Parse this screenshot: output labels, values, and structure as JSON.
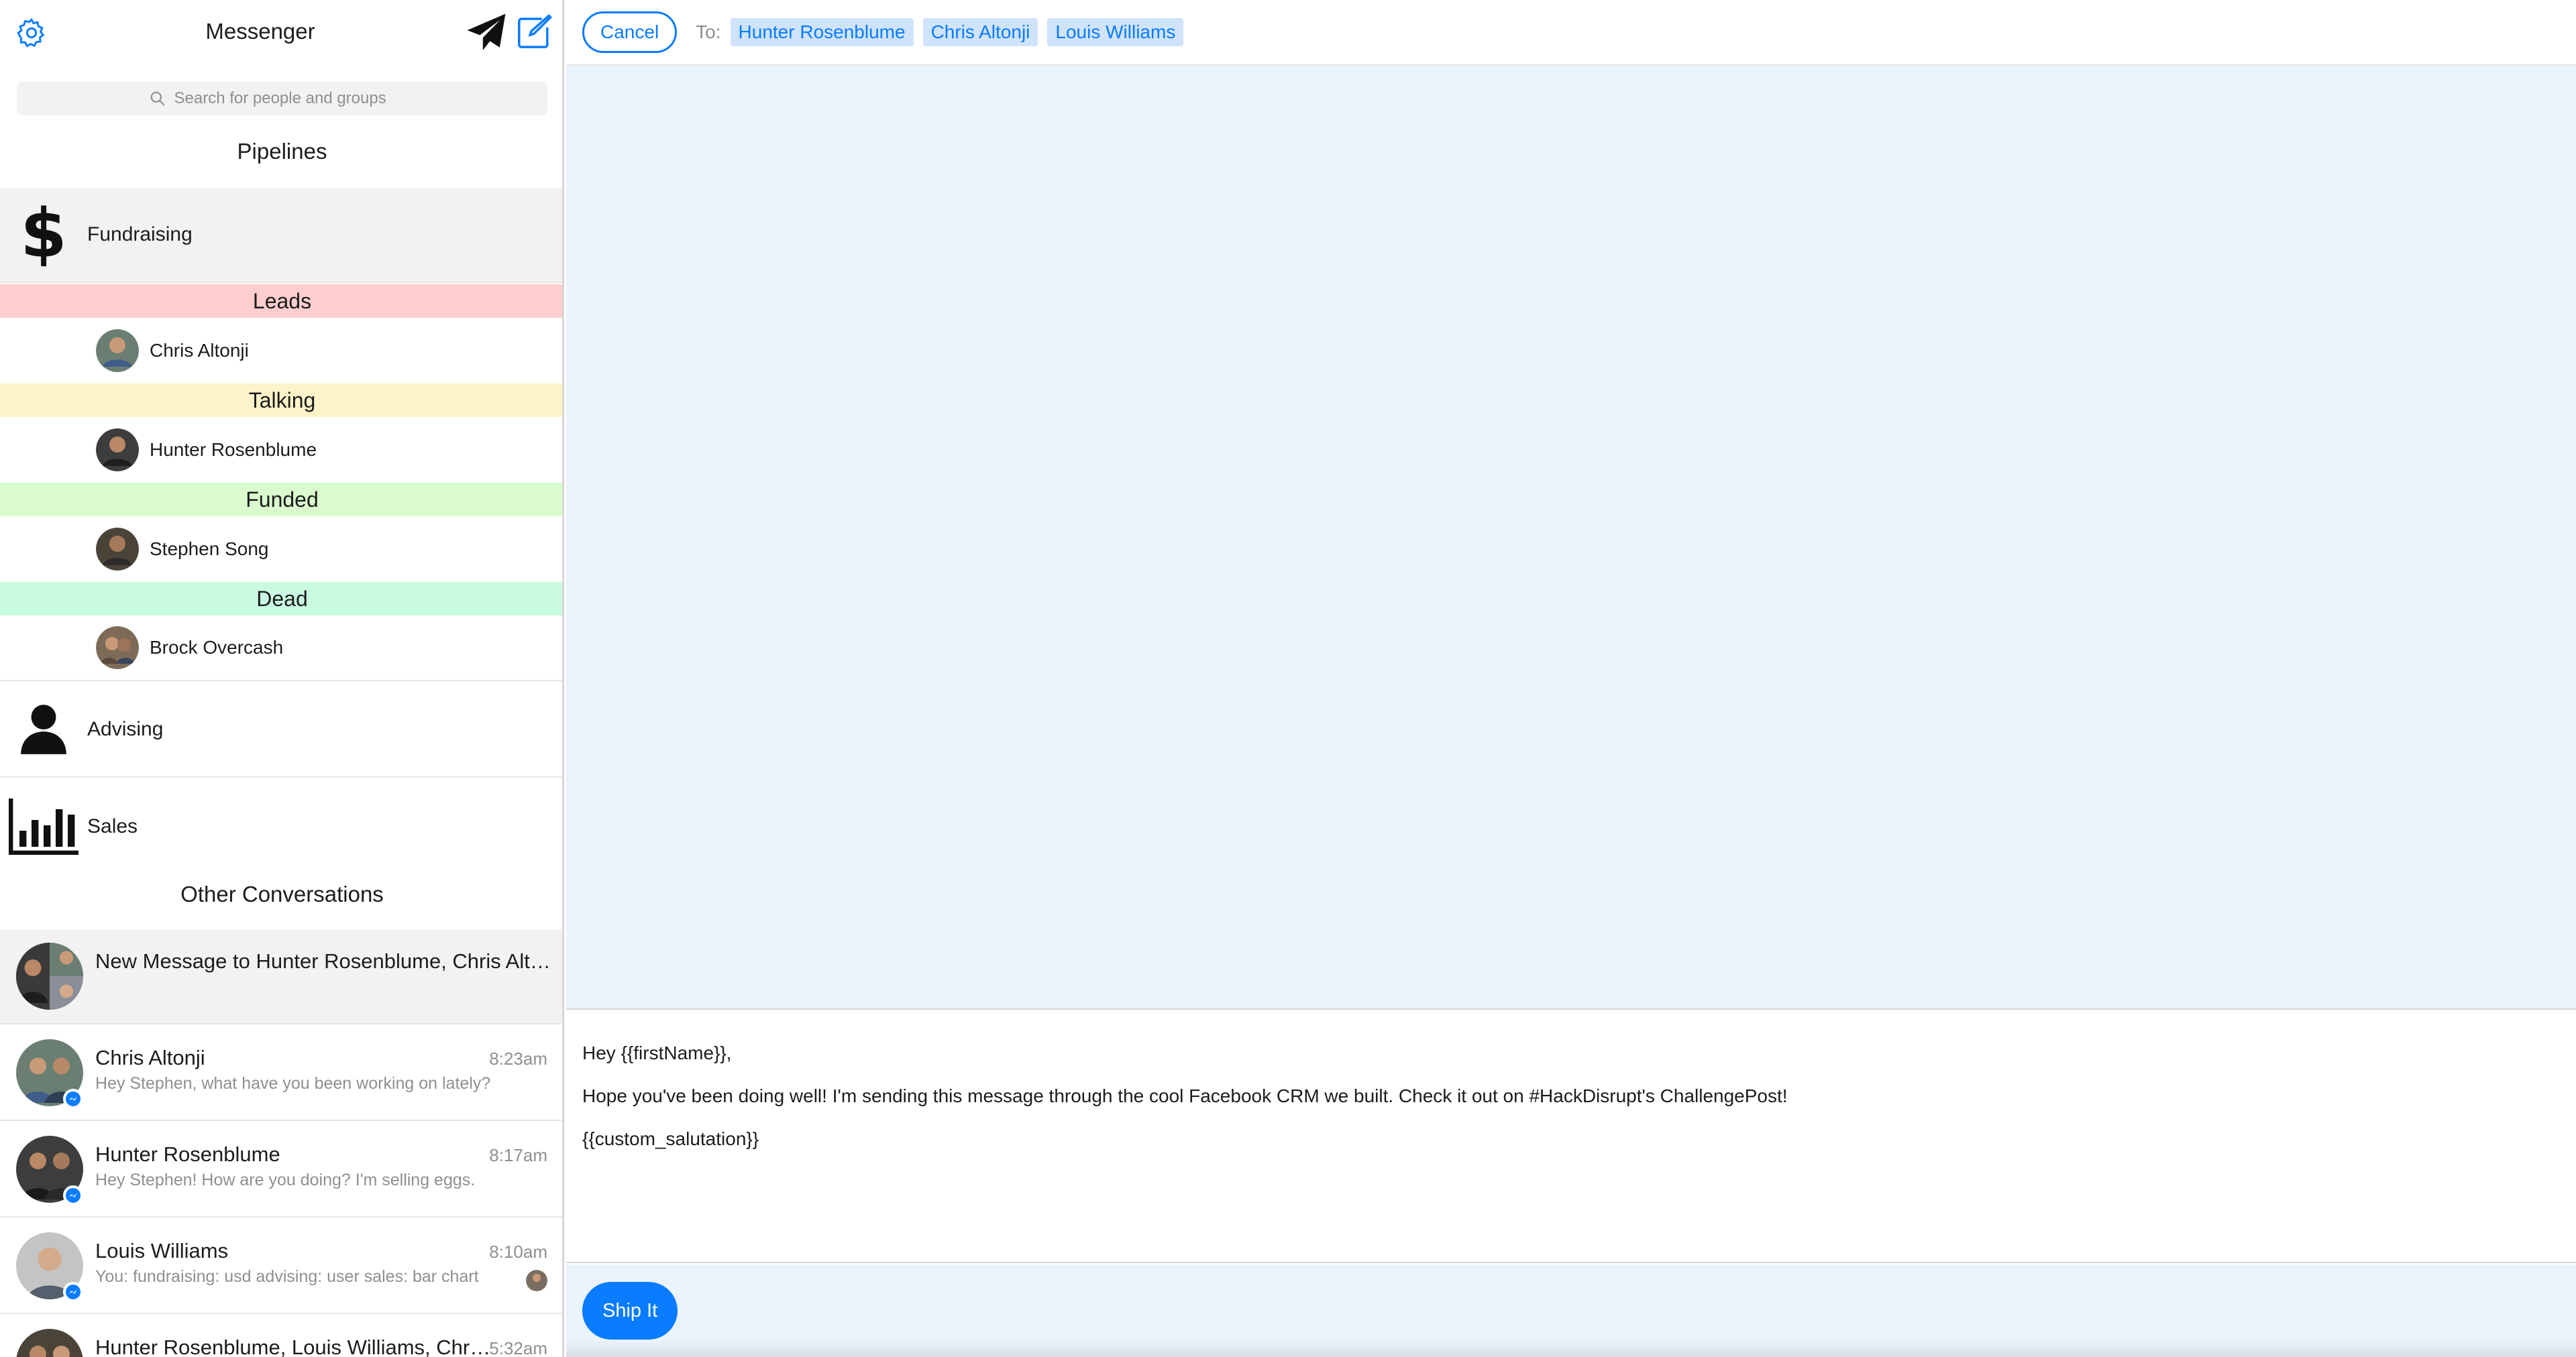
{
  "app": {
    "title": "Messenger"
  },
  "search": {
    "placeholder": "Search for people and groups"
  },
  "pipelines": {
    "heading": "Pipelines",
    "fundraising": {
      "label": "Fundraising",
      "stages": [
        {
          "name": "Leads",
          "color": "#fecdcd",
          "person": "Chris Altonji"
        },
        {
          "name": "Talking",
          "color": "#fdf3c8",
          "person": "Hunter Rosenblume"
        },
        {
          "name": "Funded",
          "color": "#d9fbce",
          "person": "Stephen Song"
        },
        {
          "name": "Dead",
          "color": "#c9fbe0",
          "person": "Brock Overcash"
        }
      ]
    },
    "advising": {
      "label": "Advising"
    },
    "sales": {
      "label": "Sales"
    }
  },
  "other": {
    "heading": "Other Conversations",
    "conversations": [
      {
        "name": "New Message to Hunter Rosenblume, Chris Altonji, Louis Williams",
        "time": "",
        "preview": ""
      },
      {
        "name": "Chris Altonji",
        "time": "8:23am",
        "preview": "Hey Stephen, what have you been working on lately?"
      },
      {
        "name": "Hunter Rosenblume",
        "time": "8:17am",
        "preview": "Hey Stephen! How are you doing? I'm selling eggs."
      },
      {
        "name": "Louis Williams",
        "time": "8:10am",
        "preview": "You: fundraising: usd advising: user sales: bar chart"
      },
      {
        "name": "Hunter Rosenblume, Louis Williams, Chris Altonji",
        "time": "5:32am",
        "preview": ""
      }
    ]
  },
  "compose": {
    "cancel_label": "Cancel",
    "to_label": "To:",
    "recipients": [
      "Hunter Rosenblume",
      "Chris Altonji",
      "Louis Williams"
    ],
    "lines": [
      "Hey {{firstName}},",
      "Hope you've been doing well! I'm sending this message through the cool Facebook CRM we built. Check it out on #HackDisrupt's ChallengePost!",
      "{{custom_salutation}}"
    ],
    "send_label": "Ship It"
  },
  "colors": {
    "accent": "#0a7cff",
    "thread_bg": "#ebf3fd",
    "chip_bg": "#cfe3fb"
  }
}
